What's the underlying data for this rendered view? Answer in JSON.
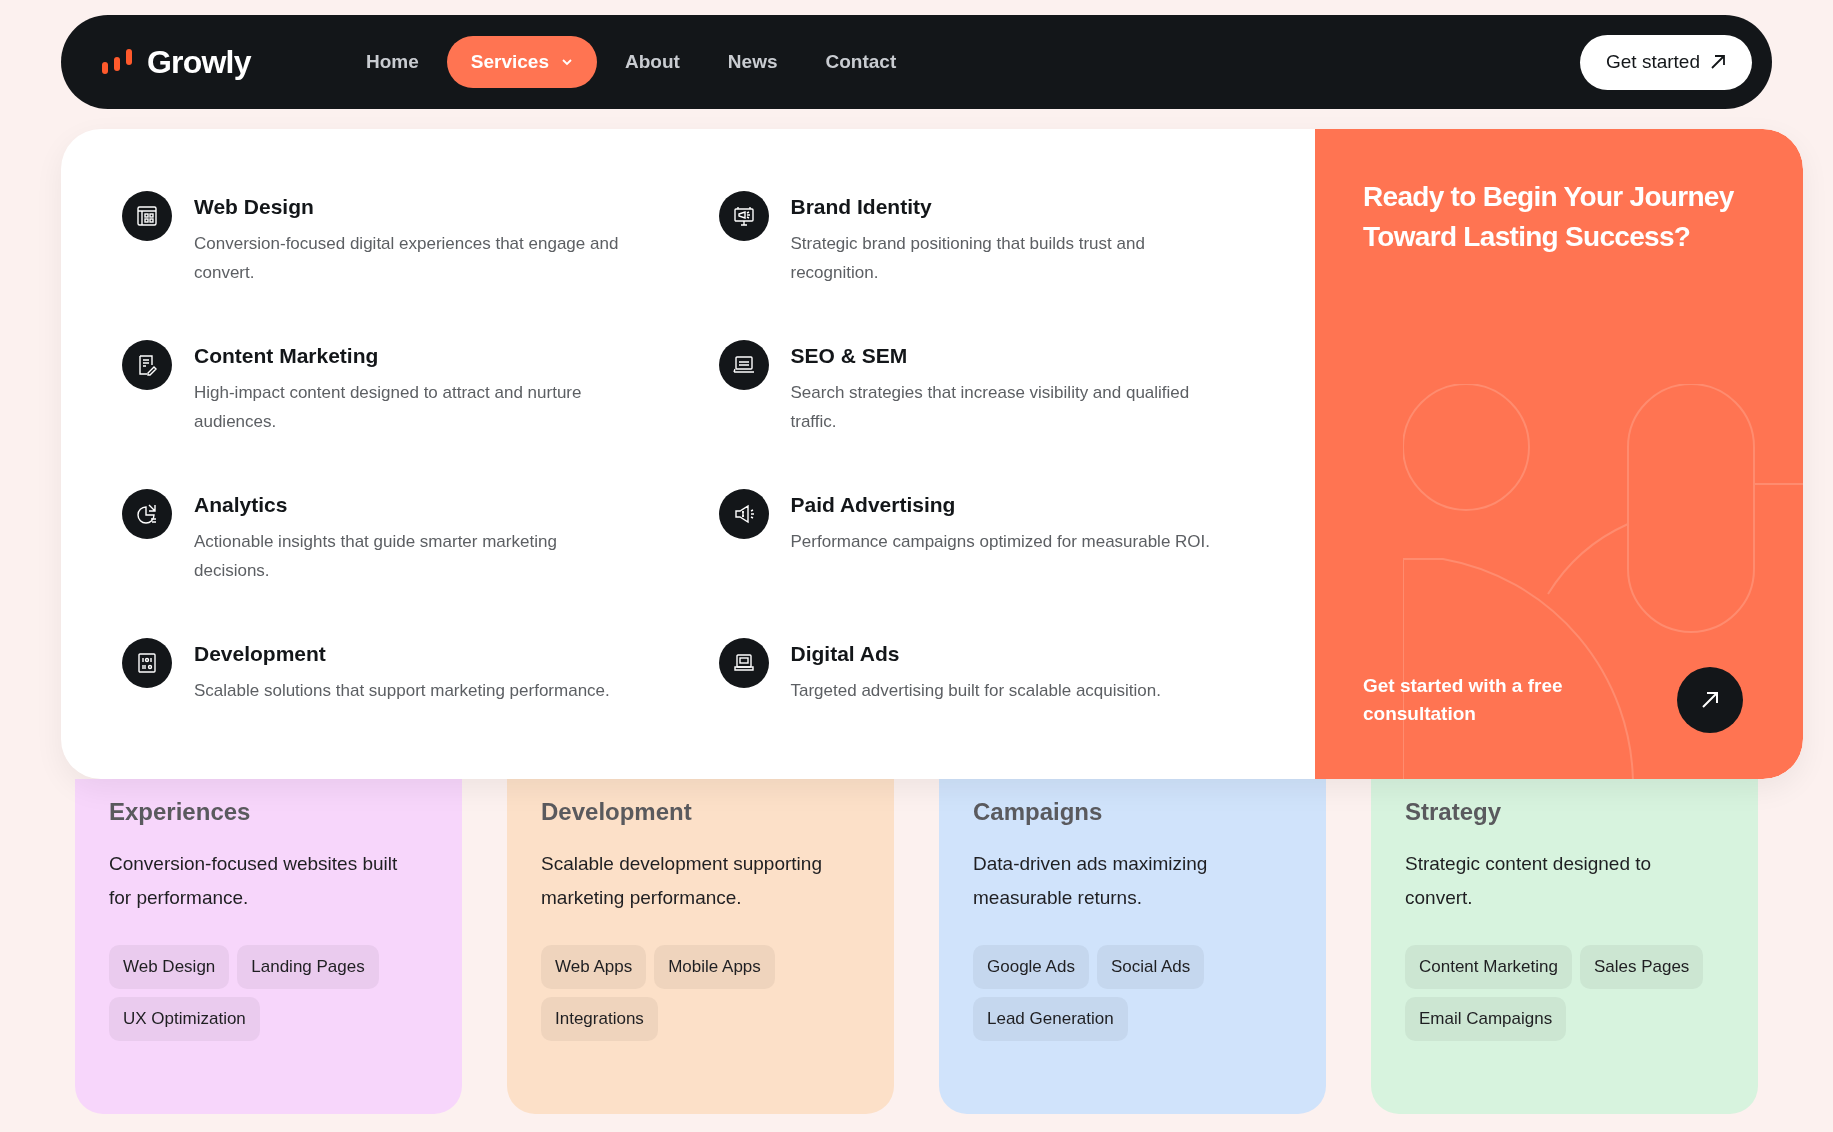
{
  "nav": {
    "brand": "Growly",
    "items": [
      {
        "label": "Home",
        "selected": false,
        "dropdown": false
      },
      {
        "label": "Services",
        "selected": true,
        "dropdown": true
      },
      {
        "label": "About",
        "selected": false,
        "dropdown": false
      },
      {
        "label": "News",
        "selected": false,
        "dropdown": false
      },
      {
        "label": "Contact",
        "selected": false,
        "dropdown": false
      }
    ],
    "cta": "Get started"
  },
  "services_menu": {
    "items": [
      {
        "kind": "browser",
        "title": "Web Design",
        "description": "Conversion-focused digital experiences that engage and convert."
      },
      {
        "kind": "billboard",
        "title": "Brand Identity",
        "description": "Strategic brand positioning that builds trust and recognition."
      },
      {
        "kind": "document",
        "title": "Content Marketing",
        "description": "High-impact content designed to attract and nurture audiences."
      },
      {
        "kind": "laptop",
        "title": "SEO & SEM",
        "description": "Search strategies that increase visibility and qualified traffic."
      },
      {
        "kind": "chart",
        "title": "Analytics",
        "description": "Actionable insights that guide smarter marketing decisions."
      },
      {
        "kind": "megaphone",
        "title": "Paid Advertising",
        "description": "Performance campaigns optimized for measurable ROI."
      },
      {
        "kind": "code",
        "title": "Development",
        "description": "Scalable solutions that support marketing performance."
      },
      {
        "kind": "ad",
        "title": "Digital Ads",
        "description": "Targeted advertising built for scalable acquisition."
      }
    ],
    "promo": {
      "heading": "Ready to Begin Your Journey Toward Lasting Success?",
      "text": "Get started with a free consultation"
    }
  },
  "cards": [
    {
      "color": "#f7d6fb",
      "title": "Experiences",
      "description": "Conversion-focused websites built for performance.",
      "tags": [
        "Web Design",
        "Landing Pages",
        "UX Optimization"
      ]
    },
    {
      "color": "#fce0c8",
      "title": "Development",
      "description": "Scalable development supporting marketing performance.",
      "tags": [
        "Web Apps",
        "Mobile Apps",
        "Integrations"
      ]
    },
    {
      "color": "#d0e3fb",
      "title": "Campaigns",
      "description": "Data-driven ads maximizing measurable returns.",
      "tags": [
        "Google Ads",
        "Social Ads",
        "Lead Generation"
      ]
    },
    {
      "color": "#d7f3de",
      "title": "Strategy",
      "description": "Strategic content designed to convert.",
      "tags": [
        "Content Marketing",
        "Sales Pages",
        "Email Campaigns"
      ]
    }
  ]
}
